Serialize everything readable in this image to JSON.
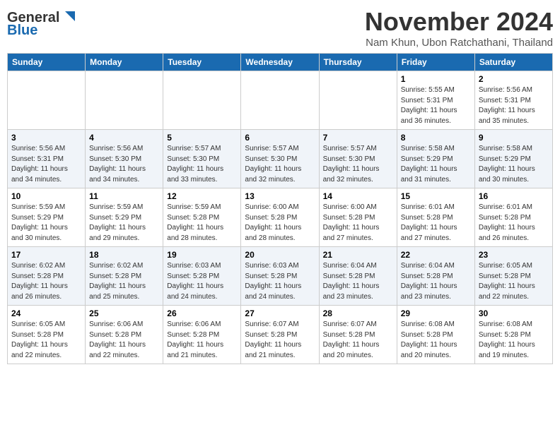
{
  "header": {
    "logo_line1": "General",
    "logo_line2": "Blue",
    "month": "November 2024",
    "location": "Nam Khun, Ubon Ratchathani, Thailand"
  },
  "days_of_week": [
    "Sunday",
    "Monday",
    "Tuesday",
    "Wednesday",
    "Thursday",
    "Friday",
    "Saturday"
  ],
  "weeks": [
    [
      {
        "day": "",
        "info": ""
      },
      {
        "day": "",
        "info": ""
      },
      {
        "day": "",
        "info": ""
      },
      {
        "day": "",
        "info": ""
      },
      {
        "day": "",
        "info": ""
      },
      {
        "day": "1",
        "info": "Sunrise: 5:55 AM\nSunset: 5:31 PM\nDaylight: 11 hours and 36 minutes."
      },
      {
        "day": "2",
        "info": "Sunrise: 5:56 AM\nSunset: 5:31 PM\nDaylight: 11 hours and 35 minutes."
      }
    ],
    [
      {
        "day": "3",
        "info": "Sunrise: 5:56 AM\nSunset: 5:31 PM\nDaylight: 11 hours and 34 minutes."
      },
      {
        "day": "4",
        "info": "Sunrise: 5:56 AM\nSunset: 5:30 PM\nDaylight: 11 hours and 34 minutes."
      },
      {
        "day": "5",
        "info": "Sunrise: 5:57 AM\nSunset: 5:30 PM\nDaylight: 11 hours and 33 minutes."
      },
      {
        "day": "6",
        "info": "Sunrise: 5:57 AM\nSunset: 5:30 PM\nDaylight: 11 hours and 32 minutes."
      },
      {
        "day": "7",
        "info": "Sunrise: 5:57 AM\nSunset: 5:30 PM\nDaylight: 11 hours and 32 minutes."
      },
      {
        "day": "8",
        "info": "Sunrise: 5:58 AM\nSunset: 5:29 PM\nDaylight: 11 hours and 31 minutes."
      },
      {
        "day": "9",
        "info": "Sunrise: 5:58 AM\nSunset: 5:29 PM\nDaylight: 11 hours and 30 minutes."
      }
    ],
    [
      {
        "day": "10",
        "info": "Sunrise: 5:59 AM\nSunset: 5:29 PM\nDaylight: 11 hours and 30 minutes."
      },
      {
        "day": "11",
        "info": "Sunrise: 5:59 AM\nSunset: 5:29 PM\nDaylight: 11 hours and 29 minutes."
      },
      {
        "day": "12",
        "info": "Sunrise: 5:59 AM\nSunset: 5:28 PM\nDaylight: 11 hours and 28 minutes."
      },
      {
        "day": "13",
        "info": "Sunrise: 6:00 AM\nSunset: 5:28 PM\nDaylight: 11 hours and 28 minutes."
      },
      {
        "day": "14",
        "info": "Sunrise: 6:00 AM\nSunset: 5:28 PM\nDaylight: 11 hours and 27 minutes."
      },
      {
        "day": "15",
        "info": "Sunrise: 6:01 AM\nSunset: 5:28 PM\nDaylight: 11 hours and 27 minutes."
      },
      {
        "day": "16",
        "info": "Sunrise: 6:01 AM\nSunset: 5:28 PM\nDaylight: 11 hours and 26 minutes."
      }
    ],
    [
      {
        "day": "17",
        "info": "Sunrise: 6:02 AM\nSunset: 5:28 PM\nDaylight: 11 hours and 26 minutes."
      },
      {
        "day": "18",
        "info": "Sunrise: 6:02 AM\nSunset: 5:28 PM\nDaylight: 11 hours and 25 minutes."
      },
      {
        "day": "19",
        "info": "Sunrise: 6:03 AM\nSunset: 5:28 PM\nDaylight: 11 hours and 24 minutes."
      },
      {
        "day": "20",
        "info": "Sunrise: 6:03 AM\nSunset: 5:28 PM\nDaylight: 11 hours and 24 minutes."
      },
      {
        "day": "21",
        "info": "Sunrise: 6:04 AM\nSunset: 5:28 PM\nDaylight: 11 hours and 23 minutes."
      },
      {
        "day": "22",
        "info": "Sunrise: 6:04 AM\nSunset: 5:28 PM\nDaylight: 11 hours and 23 minutes."
      },
      {
        "day": "23",
        "info": "Sunrise: 6:05 AM\nSunset: 5:28 PM\nDaylight: 11 hours and 22 minutes."
      }
    ],
    [
      {
        "day": "24",
        "info": "Sunrise: 6:05 AM\nSunset: 5:28 PM\nDaylight: 11 hours and 22 minutes."
      },
      {
        "day": "25",
        "info": "Sunrise: 6:06 AM\nSunset: 5:28 PM\nDaylight: 11 hours and 22 minutes."
      },
      {
        "day": "26",
        "info": "Sunrise: 6:06 AM\nSunset: 5:28 PM\nDaylight: 11 hours and 21 minutes."
      },
      {
        "day": "27",
        "info": "Sunrise: 6:07 AM\nSunset: 5:28 PM\nDaylight: 11 hours and 21 minutes."
      },
      {
        "day": "28",
        "info": "Sunrise: 6:07 AM\nSunset: 5:28 PM\nDaylight: 11 hours and 20 minutes."
      },
      {
        "day": "29",
        "info": "Sunrise: 6:08 AM\nSunset: 5:28 PM\nDaylight: 11 hours and 20 minutes."
      },
      {
        "day": "30",
        "info": "Sunrise: 6:08 AM\nSunset: 5:28 PM\nDaylight: 11 hours and 19 minutes."
      }
    ]
  ]
}
